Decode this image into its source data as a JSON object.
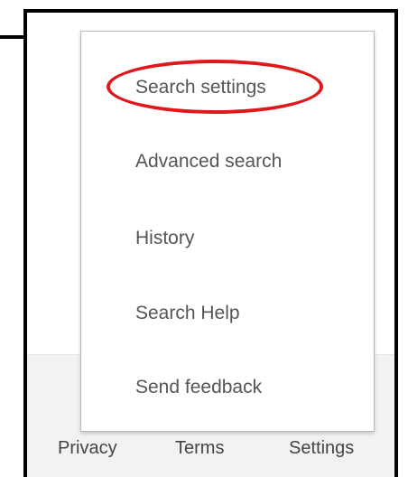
{
  "menu": {
    "items": [
      {
        "label": "Search settings"
      },
      {
        "label": "Advanced search"
      },
      {
        "label": "History"
      },
      {
        "label": "Search Help"
      },
      {
        "label": "Send feedback"
      }
    ]
  },
  "footer": {
    "privacy_label": "Privacy",
    "terms_label": "Terms",
    "settings_label": "Settings"
  },
  "colors": {
    "annotation": "#e0181b",
    "frame": "#000000",
    "footer_bg": "#f2f2f2",
    "menu_text": "#555555"
  }
}
